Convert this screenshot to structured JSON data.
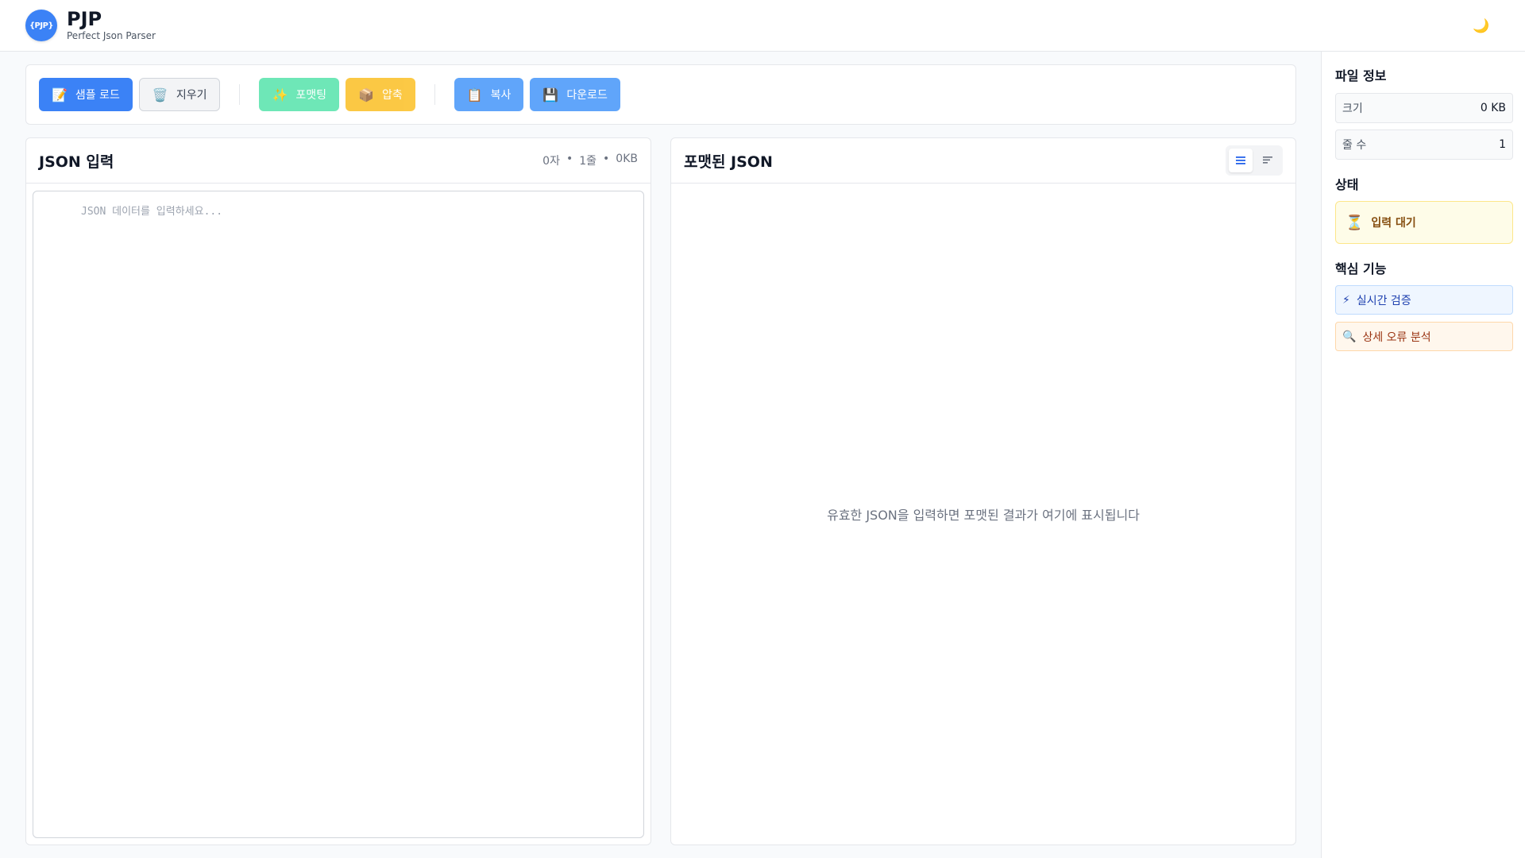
{
  "header": {
    "logo_text": "{PJP}",
    "title": "PJP",
    "subtitle": "Perfect Json Parser",
    "theme_icon": "moon-icon"
  },
  "toolbar": {
    "sample_label": "샘플 로드",
    "clear_label": "지우기",
    "format_label": "포맷팅",
    "minify_label": "압축",
    "copy_label": "복사",
    "download_label": "다운로드"
  },
  "input_panel": {
    "title": "JSON 입력",
    "chars": "0자",
    "lines": "1줄",
    "size": "0KB",
    "sep": "•",
    "placeholder": "JSON 데이터를 입력하세요...",
    "value": ""
  },
  "output_panel": {
    "title": "포맷된 JSON",
    "empty_message": "유효한 JSON을 입력하면 포맷된 결과가 여기에 표시됩니다"
  },
  "sidebar": {
    "file_info_title": "파일 정보",
    "size_label": "크기",
    "size_value": "0 KB",
    "lines_label": "줄 수",
    "lines_value": "1",
    "status_title": "상태",
    "status_text": "입력 대기",
    "features_title": "핵심 기능",
    "feature_1": "실시간 검증",
    "feature_2": "상세 오류 분석"
  },
  "colors": {
    "primary": "#3b82f6",
    "success": "#6ee7b7",
    "warning": "#fbbf24",
    "status_bg": "#fefce8"
  }
}
